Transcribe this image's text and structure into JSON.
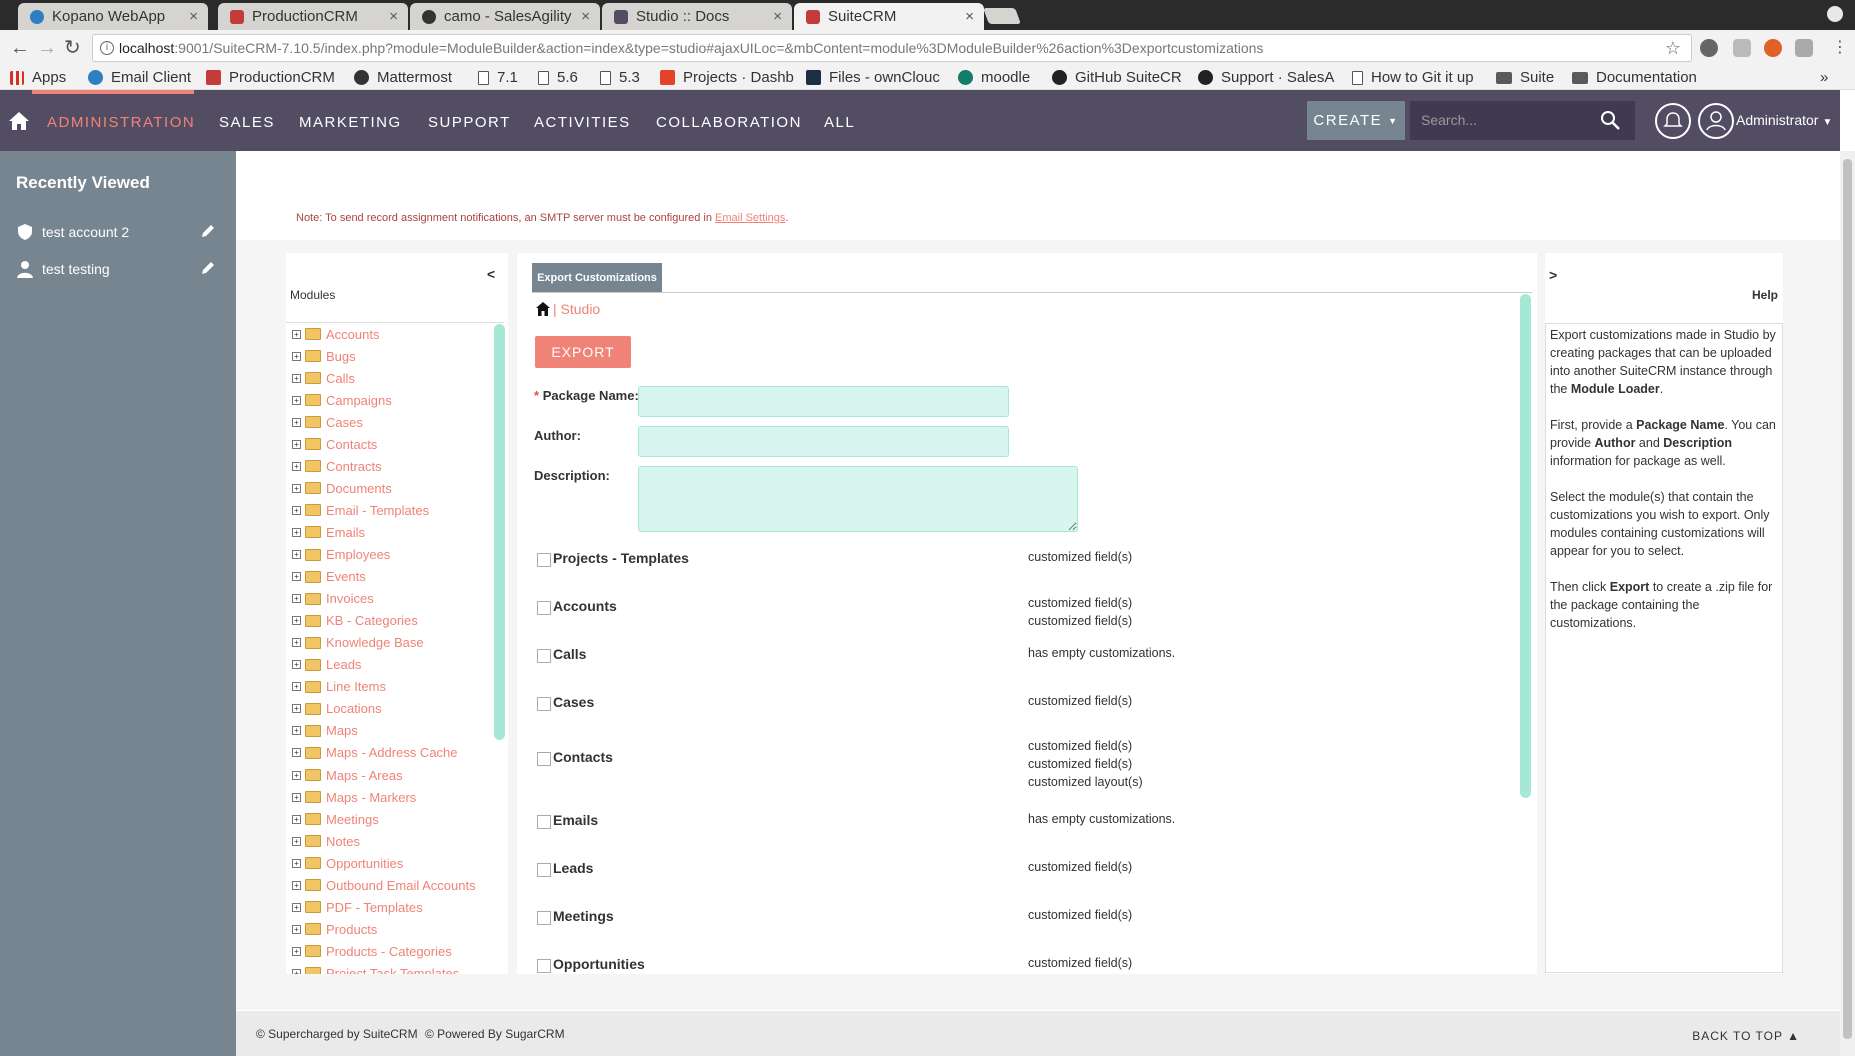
{
  "browser": {
    "tabs": [
      {
        "title": "Kopano WebApp",
        "icon_color": "#2d7fc1",
        "close": "×"
      },
      {
        "title": "ProductionCRM",
        "icon_color": "#c33b3b",
        "close": "×"
      },
      {
        "title": "camo - SalesAgility",
        "icon_color": "#333333",
        "close": "×"
      },
      {
        "title": "Studio :: Docs",
        "icon_color": "#534d64",
        "close": "×"
      },
      {
        "title": "SuiteCRM",
        "icon_color": "#c33b3b",
        "close": "×"
      }
    ],
    "url_host": "localhost",
    "url_path": ":9001/SuiteCRM-7.10.5/index.php?module=ModuleBuilder&action=index&type=studio#ajaxUILoc=&mbContent=module%3DModuleBuilder%26action%3Dexportcustomizations",
    "bookmarks": [
      {
        "label": "Apps",
        "icon": "apps-grid-icon"
      },
      {
        "label": "Email Client",
        "icon": "kopano-icon"
      },
      {
        "label": "ProductionCRM",
        "icon": "suitecrm-icon"
      },
      {
        "label": "Mattermost",
        "icon": "mattermost-icon"
      },
      {
        "label": "7.1",
        "icon": "page-icon"
      },
      {
        "label": "5.6",
        "icon": "page-icon"
      },
      {
        "label": "5.3",
        "icon": "page-icon"
      },
      {
        "label": "Projects · Dashb",
        "icon": "gitlab-icon"
      },
      {
        "label": "Files - ownClouc",
        "icon": "owncloud-icon"
      },
      {
        "label": "moodle",
        "icon": "moodle-icon"
      },
      {
        "label": "GitHub SuiteCR",
        "icon": "github-icon"
      },
      {
        "label": "Support · SalesA",
        "icon": "github-icon"
      },
      {
        "label": "How to Git it up",
        "icon": "page-icon"
      },
      {
        "label": "Suite",
        "icon": "folder-icon"
      },
      {
        "label": "Documentation",
        "icon": "folder-icon"
      }
    ],
    "more_bookmarks": "»"
  },
  "nav": {
    "items": [
      "ADMINISTRATION",
      "SALES",
      "MARKETING",
      "SUPPORT",
      "ACTIVITIES",
      "COLLABORATION",
      "ALL"
    ],
    "create_label": "CREATE",
    "search_placeholder": "Search...",
    "user_label": "Administrator"
  },
  "sidebar": {
    "title": "Recently Viewed",
    "items": [
      {
        "label": "test account 2",
        "icon": "account-shield-icon"
      },
      {
        "label": "test testing",
        "icon": "person-icon"
      }
    ]
  },
  "note": {
    "text": "Note: To send record assignment notifications, an SMTP server must be configured in ",
    "link": "Email Settings",
    "end": "."
  },
  "modules_panel": {
    "title": "Modules",
    "collapse": "<",
    "items": [
      "Accounts",
      "Bugs",
      "Calls",
      "Campaigns",
      "Cases",
      "Contacts",
      "Contracts",
      "Documents",
      "Email - Templates",
      "Emails",
      "Employees",
      "Events",
      "Invoices",
      "KB - Categories",
      "Knowledge Base",
      "Leads",
      "Line Items",
      "Locations",
      "Maps",
      "Maps - Address Cache",
      "Maps - Areas",
      "Maps - Markers",
      "Meetings",
      "Notes",
      "Opportunities",
      "Outbound Email Accounts",
      "PDF - Templates",
      "Products",
      "Products - Categories",
      "Project Task Templates"
    ]
  },
  "main": {
    "tab_label": "Export Customizations",
    "breadcrumb": "| Studio",
    "export_button": "EXPORT",
    "fields": {
      "required_mark": "*",
      "package_name": "Package Name:",
      "author": "Author:",
      "description": "Description:"
    },
    "module_rows": [
      {
        "name": "Projects - Templates",
        "desc": [
          "customized field(s)"
        ]
      },
      {
        "name": "Accounts",
        "desc": [
          "customized field(s)",
          "customized field(s)"
        ]
      },
      {
        "name": "Calls",
        "desc": [
          "has empty customizations."
        ]
      },
      {
        "name": "Cases",
        "desc": [
          "customized field(s)"
        ]
      },
      {
        "name": "Contacts",
        "desc": [
          "customized field(s)",
          "customized field(s)",
          "customized layout(s)"
        ]
      },
      {
        "name": "Emails",
        "desc": [
          "has empty customizations."
        ]
      },
      {
        "name": "Leads",
        "desc": [
          "customized field(s)"
        ]
      },
      {
        "name": "Meetings",
        "desc": [
          "customized field(s)"
        ]
      },
      {
        "name": "Opportunities",
        "desc": [
          "customized field(s)"
        ]
      }
    ]
  },
  "help_panel": {
    "toggle": ">",
    "title": "Help",
    "p1_a": "Export customizations made in Studio by creating packages that can be uploaded into another SuiteCRM instance through the ",
    "p1_b": "Module Loader",
    "p1_c": ".",
    "p2_a": "First, provide a ",
    "p2_b": "Package Name",
    "p2_c": ". You can provide ",
    "p2_d": "Author",
    "p2_e": " and ",
    "p2_f": "Description",
    "p2_g": " information for package as well.",
    "p3": "Select the module(s) that contain the customizations you wish to export. Only modules containing customizations will appear for you to select.",
    "p4_a": "Then click ",
    "p4_b": "Export",
    "p4_c": " to create a .zip file for the package containing the customizations."
  },
  "footer": {
    "supercharged": "© Supercharged by SuiteCRM",
    "powered": "© Powered By SugarCRM",
    "back_to_top": "BACK TO TOP ▲"
  },
  "colors": {
    "nav_bg": "#534d64",
    "accent": "#f08377",
    "rail_bg": "#778591",
    "input_bg": "#d8f5ef"
  }
}
